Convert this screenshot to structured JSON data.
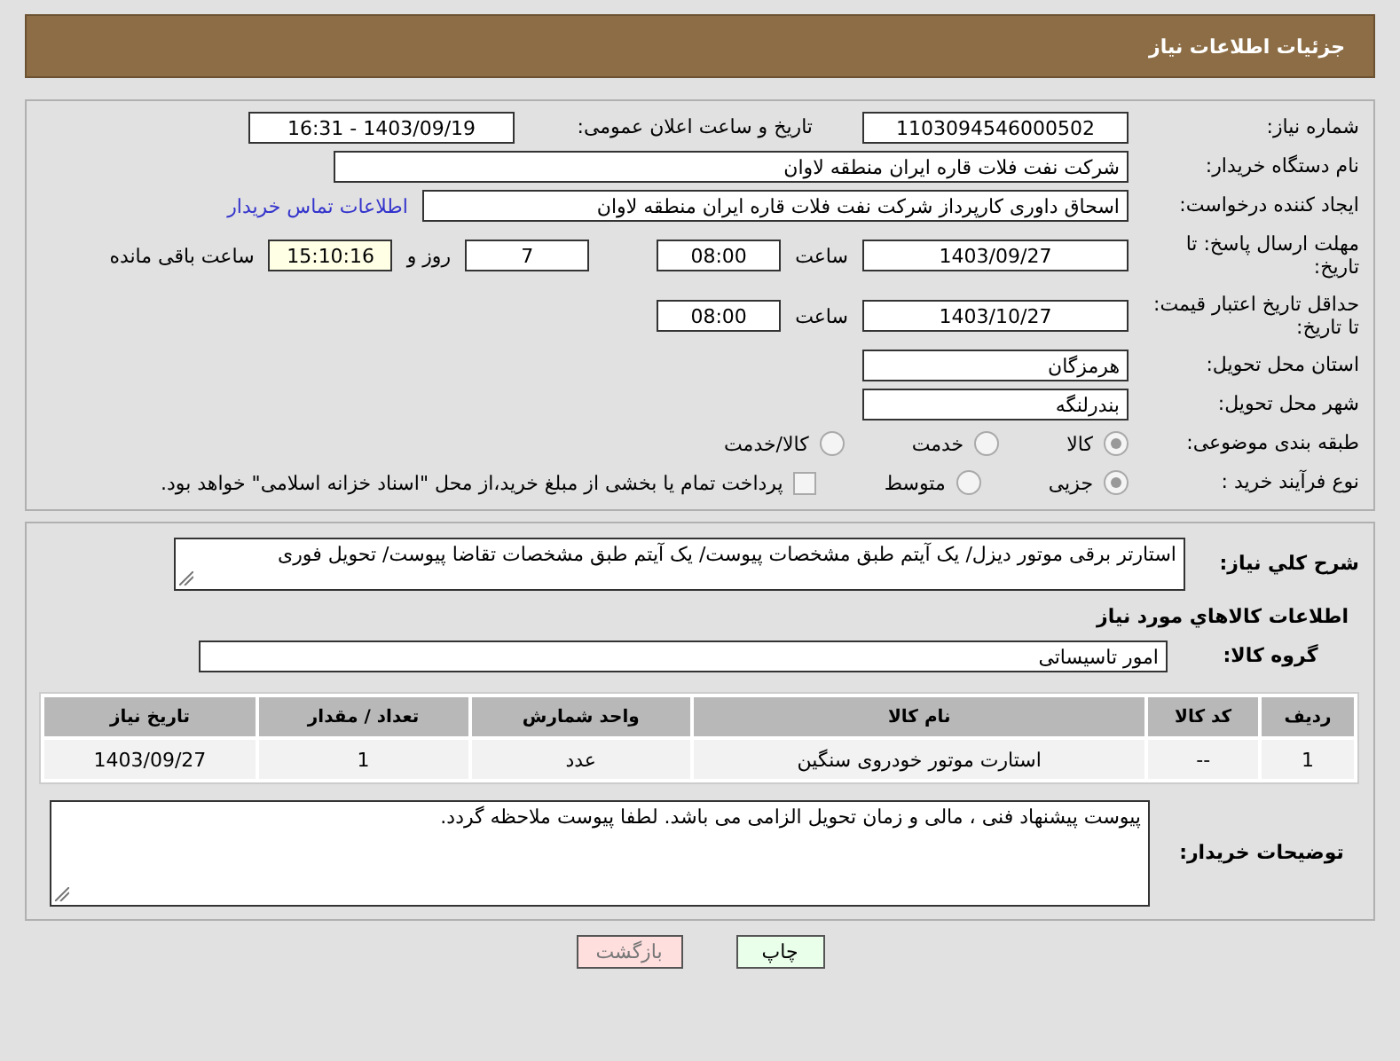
{
  "header": {
    "title": "جزئیات اطلاعات نیاز"
  },
  "need_number": {
    "label": "شماره نیاز:",
    "value": "1103094546000502"
  },
  "announce": {
    "label": "تاریخ و ساعت اعلان عمومی:",
    "value": "1403/09/19 - 16:31"
  },
  "buyer": {
    "label": "نام دستگاه خریدار:",
    "value": "شرکت نفت فلات قاره ایران منطقه لاوان"
  },
  "requester": {
    "label": "ایجاد کننده درخواست:",
    "value": "اسحاق داوری کارپرداز شرکت نفت فلات قاره ایران منطقه لاوان",
    "link": "اطلاعات تماس خریدار"
  },
  "response_deadline": {
    "label": "مهلت ارسال پاسخ: تا تاریخ:",
    "date": "1403/09/27",
    "time_label": "ساعت",
    "time": "08:00",
    "days": "7",
    "days_label": "روز و",
    "remaining": "15:10:16",
    "remaining_label": "ساعت باقی مانده"
  },
  "price_validity": {
    "label": "حداقل تاریخ اعتبار قیمت: تا تاریخ:",
    "date": "1403/10/27",
    "time_label": "ساعت",
    "time": "08:00"
  },
  "province": {
    "label": "استان محل تحویل:",
    "value": "هرمزگان"
  },
  "city": {
    "label": "شهر محل تحویل:",
    "value": "بندرلنگه"
  },
  "category": {
    "label": "طبقه بندی موضوعی:",
    "options": [
      {
        "label": "کالا",
        "selected": true
      },
      {
        "label": "خدمت",
        "selected": false
      },
      {
        "label": "کالا/خدمت",
        "selected": false
      }
    ]
  },
  "process": {
    "label": "نوع فرآیند خرید :",
    "options": [
      {
        "label": "جزیی",
        "selected": true
      },
      {
        "label": "متوسط",
        "selected": false
      }
    ],
    "treasury": {
      "label": "پرداخت تمام یا بخشی از مبلغ خرید،از محل \"اسناد خزانه اسلامی\" خواهد بود.",
      "checked": false
    }
  },
  "description": {
    "label": "شرح کلي نياز:",
    "value": "استارتر برقی موتور دیزل/ یک آیتم طبق مشخصات پیوست/ یک آیتم طبق مشخصات تقاضا پیوست/ تحویل فوری"
  },
  "goods_title": "اطلاعات كالاهاي مورد نياز",
  "goods_group": {
    "label": "گروه کالا:",
    "value": "امور تاسیساتی"
  },
  "table": {
    "columns": [
      "ردیف",
      "کد کالا",
      "نام کالا",
      "واحد شمارش",
      "تعداد / مقدار",
      "تاریخ نیاز"
    ],
    "rows": [
      [
        "1",
        "--",
        "استارت موتور خودروی سنگین",
        "عدد",
        "1",
        "1403/09/27"
      ]
    ]
  },
  "buyer_notes": {
    "label": "توضیحات خریدار:",
    "value": "پیوست پیشنهاد فنی ، مالی و زمان تحویل الزامی می باشد. لطفا پیوست ملاحظه گردد."
  },
  "buttons": [
    {
      "label": "چاپ",
      "kind": "print"
    },
    {
      "label": "بازگشت",
      "kind": "back"
    }
  ]
}
